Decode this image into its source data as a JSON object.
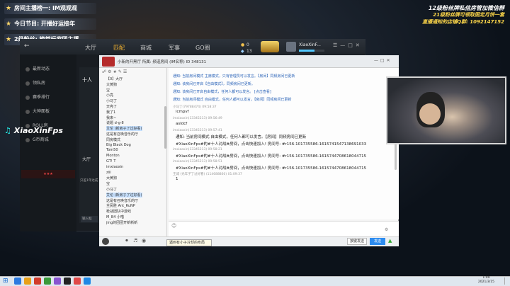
{
  "overlay": {
    "banners": [
      "房间主播榜一: IM观观观",
      "今日节目: 开播好运接年",
      "2级粉丝: 榜首玩家团主播"
    ],
    "right_lines": [
      {
        "text": "12级粉丝牌私信房管加微信群",
        "color": "#ffffff"
      },
      {
        "text": "21级粉丝牌可领取固定月饼一套",
        "color": "#ffd84a"
      },
      {
        "text": "直播通知的店铺Q群: 1092147152",
        "color": "#ffd84a"
      }
    ],
    "tiktok": "XiaoXinFps"
  },
  "client": {
    "nav": [
      "大厅",
      "匹配",
      "商城",
      "军事",
      "GO圈"
    ],
    "active_nav": 1,
    "coins": "0",
    "points": "13",
    "username": "XiaoXinF...",
    "sidebar": [
      "最新动态",
      "领私房",
      "赛季排行",
      "大神面板",
      "ROLL房",
      "G币商城"
    ],
    "mid_label": "十人",
    "mid_label2": "大厅",
    "mid_hint": "只差1年达成",
    "enter_label": "输入框"
  },
  "chat": {
    "title": "小新的开黑厅   所属: 频道房间 (IM名称)   ID 348131",
    "tree": [
      {
        "label": "【0】大厅",
        "sel": false
      },
      {
        "label": "大黄狗",
        "sel": false
      },
      {
        "label": "宝",
        "sel": false
      },
      {
        "label": "小亮",
        "sel": false
      },
      {
        "label": "小马丁",
        "sel": false
      },
      {
        "label": "天亮了",
        "sel": false
      },
      {
        "label": "我了1",
        "sel": false
      },
      {
        "label": "我来~",
        "sel": false
      },
      {
        "label": "说题 d-g-8",
        "sel": false
      },
      {
        "label": "艾伦 (新房子了过好看)",
        "sel": true
      },
      {
        "label": "这是有召唤音乐的厅",
        "sel": false
      },
      {
        "label": "同房模式",
        "sel": false
      },
      {
        "label": "Big Black Dog",
        "sel": false
      },
      {
        "label": "Tom50",
        "sel": false
      },
      {
        "label": "Monton",
        "sel": false
      },
      {
        "label": "GT! T",
        "sel": false
      },
      {
        "label": "imxiaoxin",
        "sel": false
      },
      {
        "label": "ziii",
        "sel": false
      },
      {
        "label": "大黄狗",
        "sel": false
      },
      {
        "label": "宝",
        "sel": false
      },
      {
        "label": "小马丁",
        "sel": false
      },
      {
        "label": "艾伦 (新房子了过好看)",
        "sel": true
      },
      {
        "label": "这是有召唤音乐的厅",
        "sel": false
      },
      {
        "label": "全民胜 Ant_RuNP",
        "sel": false
      },
      {
        "label": "枪战团队中游戏",
        "sel": false
      },
      {
        "label": "M_B4 小喵",
        "sel": false
      },
      {
        "label": "jing的团团开新新新",
        "sel": false
      }
    ],
    "system_notes": [
      "通知: 当前房间模式 主席模式，只有管理员可以发言。【房间】同频房间已更新",
      "通知: 该房间已开启【自由模式】，同频房间已更新。",
      "通知: 该房间已开启自由模式，任何人都可以发言。 [点击查看]",
      "通知: 当前房间模式 自由模式，任何人都可以发言。【房间】同频房间已更新"
    ],
    "messages": [
      {
        "meta": "小马丁(79788474) 09:58:37",
        "text": "lcmpvf"
      },
      {
        "meta": "imxiaoxin(13345213) 09:56:49",
        "text": "asldcf"
      },
      {
        "meta": "imxiaoxin(13345213) 09:57:41",
        "text": "通知: 当前房间模式 自由模式，任何人都可以发言。【房间】同频房间已更新"
      },
      {
        "meta": "",
        "text": "#XiaoXinFps#的#十人对战#房间，点击快速加入! 房间号: #r156-101735586-1615741547138691033"
      },
      {
        "meta": "imxiaoxin(13345213) 09:58:21",
        "text": "#XiaoXinFps#的#十人对战#房间，点击快速加入! 房间号: #r156-101735586-1615744708618044715"
      },
      {
        "meta": "imxiaoxin(13345213) 09:58:51",
        "text": "#XiaoXinFps#的#十人对战#房间，点击快速加入! 房间号: #r156-101735586-1615744708618044715"
      },
      {
        "meta": "王城 (光年子了过好看) (114688860) 01:09:37",
        "text": "1"
      }
    ],
    "send_label": "发送",
    "send_mode": "按键发送",
    "tooltip": "遇到有小子冷却的布局"
  },
  "taskbar": {
    "time": "1:09",
    "date": "2021/3/15",
    "icon_colors": [
      "#2c7ae0",
      "#e8a01a",
      "#d23b2b",
      "#3a9a3a",
      "#8854d0",
      "#222222",
      "#e04848",
      "#1e88e5"
    ]
  }
}
